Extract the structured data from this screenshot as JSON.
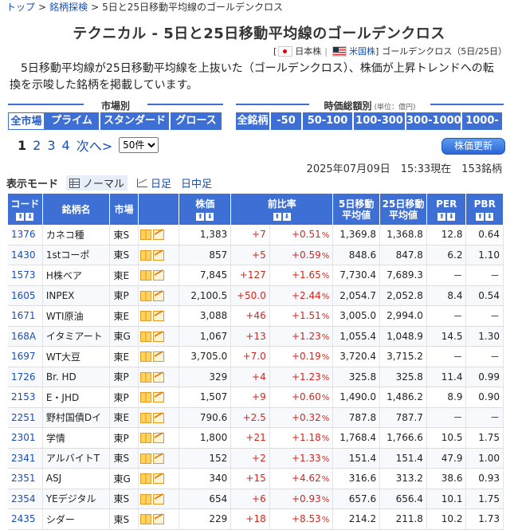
{
  "breadcrumb": {
    "top": "トップ",
    "sep1": ">",
    "search": "銘柄探検",
    "sep2": ">",
    "current": "5日と25日移動平均線のゴールデンクロス"
  },
  "page": {
    "title": "テクニカル - 5日と25日移動平均線のゴールデンクロス",
    "jp_label": "日本株",
    "us_label": "米国株",
    "page_label": "ゴールデンクロス（5日/25日）",
    "description": "5日移動平均線が25日移動平均線を上抜いた（ゴールデンクロス）、株価が上昇トレンドへの転換を示唆した銘柄を掲載しています。"
  },
  "market": {
    "heading": "市場別",
    "tabs": [
      "全市場",
      "プライム",
      "スタンダード",
      "グロース"
    ],
    "active": 0
  },
  "cap": {
    "heading": "時価総額別",
    "unit": "(単位：億円)",
    "tabs": [
      "全銘柄",
      "-50",
      "50-100",
      "100-300",
      "300-1000",
      "1000-"
    ]
  },
  "pager": {
    "current": "1",
    "pages": [
      "2",
      "3",
      "4"
    ],
    "next": "次へ>",
    "per_page": "50件"
  },
  "refresh_label": "株価更新",
  "timestamp": "2025年07月09日　15:33現在　153銘柄",
  "mode": {
    "label": "表示モード",
    "normal": "ノーマル",
    "daily": "日足",
    "daily_mid": "日中足"
  },
  "columns": {
    "code": "コード",
    "name": "銘柄名",
    "market": "市場",
    "price": "株価",
    "change": "前比率",
    "ma5_a": "5日移動",
    "ma5_b": "平均値",
    "ma25_a": "25日移動",
    "ma25_b": "平均値",
    "per": "PER",
    "pbr": "PBR",
    "sort_up": "⬆",
    "sort_down": "⬇"
  },
  "rows": [
    {
      "code": "1376",
      "name": "カネコ種",
      "market": "東S",
      "price": "1,383",
      "chg": "+7",
      "pct": "+0.51",
      "ma5": "1,369.8",
      "ma25": "1,368.8",
      "per": "12.8",
      "pbr": "0.64"
    },
    {
      "code": "1430",
      "name": "1stコーポ",
      "market": "東S",
      "price": "857",
      "chg": "+5",
      "pct": "+0.59",
      "ma5": "848.6",
      "ma25": "847.8",
      "per": "6.2",
      "pbr": "1.10"
    },
    {
      "code": "1573",
      "name": "H株ベア",
      "market": "東E",
      "price": "7,845",
      "chg": "+127",
      "pct": "+1.65",
      "ma5": "7,730.4",
      "ma25": "7,689.3",
      "per": "－",
      "pbr": "－"
    },
    {
      "code": "1605",
      "name": "INPEX",
      "market": "東P",
      "price": "2,100.5",
      "chg": "+50.0",
      "pct": "+2.44",
      "ma5": "2,054.7",
      "ma25": "2,052.8",
      "per": "8.4",
      "pbr": "0.54"
    },
    {
      "code": "1671",
      "name": "WTI原油",
      "market": "東E",
      "price": "3,088",
      "chg": "+46",
      "pct": "+1.51",
      "ma5": "3,005.0",
      "ma25": "2,994.0",
      "per": "－",
      "pbr": "－"
    },
    {
      "code": "168A",
      "name": "イタミアート",
      "market": "東G",
      "price": "1,067",
      "chg": "+13",
      "pct": "+1.23",
      "ma5": "1,055.4",
      "ma25": "1,048.9",
      "per": "14.5",
      "pbr": "1.30"
    },
    {
      "code": "1697",
      "name": "WT大豆",
      "market": "東E",
      "price": "3,705.0",
      "chg": "+7.0",
      "pct": "+0.19",
      "ma5": "3,720.4",
      "ma25": "3,715.2",
      "per": "－",
      "pbr": "－"
    },
    {
      "code": "1726",
      "name": "Br. HD",
      "market": "東P",
      "price": "329",
      "chg": "+4",
      "pct": "+1.23",
      "ma5": "325.8",
      "ma25": "325.8",
      "per": "11.4",
      "pbr": "0.99"
    },
    {
      "code": "2153",
      "name": "E・JHD",
      "market": "東P",
      "price": "1,507",
      "chg": "+9",
      "pct": "+0.60",
      "ma5": "1,490.0",
      "ma25": "1,486.2",
      "per": "8.9",
      "pbr": "0.90"
    },
    {
      "code": "2251",
      "name": "野村国債Dイ",
      "market": "東E",
      "price": "790.6",
      "chg": "+2.5",
      "pct": "+0.32",
      "ma5": "787.8",
      "ma25": "787.7",
      "per": "－",
      "pbr": "－"
    },
    {
      "code": "2301",
      "name": "学情",
      "market": "東P",
      "price": "1,800",
      "chg": "+21",
      "pct": "+1.18",
      "ma5": "1,768.4",
      "ma25": "1,766.6",
      "per": "10.5",
      "pbr": "1.75"
    },
    {
      "code": "2341",
      "name": "アルバイトT",
      "market": "東S",
      "price": "152",
      "chg": "+2",
      "pct": "+1.33",
      "ma5": "151.4",
      "ma25": "151.4",
      "per": "47.9",
      "pbr": "1.00"
    },
    {
      "code": "2351",
      "name": "ASJ",
      "market": "東G",
      "price": "340",
      "chg": "+15",
      "pct": "+4.62",
      "ma5": "316.6",
      "ma25": "313.2",
      "per": "38.6",
      "pbr": "0.93"
    },
    {
      "code": "2354",
      "name": "YEデジタル",
      "market": "東S",
      "price": "654",
      "chg": "+6",
      "pct": "+0.93",
      "ma5": "657.6",
      "ma25": "656.4",
      "per": "10.1",
      "pbr": "1.75"
    },
    {
      "code": "2435",
      "name": "シダー",
      "market": "東S",
      "price": "229",
      "chg": "+18",
      "pct": "+8.53",
      "ma5": "214.2",
      "ma25": "211.8",
      "per": "10.2",
      "pbr": "1.73"
    }
  ],
  "pct_unit": "%",
  "colors": {
    "accent": "#3d6fd4",
    "link": "#1a4fb5",
    "positive": "#d4261b"
  }
}
